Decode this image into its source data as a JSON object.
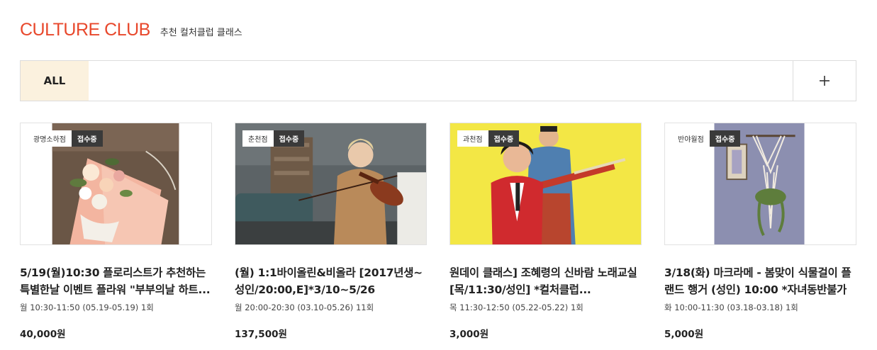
{
  "header": {
    "brand": "CULTURE CLUB",
    "subtitle": "추천 컬처클럽 클래스",
    "brand_color": "#e8482c"
  },
  "filter": {
    "tab_all": "ALL",
    "tab_active_bg": "#fbf1de",
    "more_icon": "plus-icon"
  },
  "cards": [
    {
      "branch": "광명소하점",
      "status": "접수중",
      "title": "5/19(월)10:30 플로리스트가 추천하는 특별한날 이벤트 플라워 \"부부의날 하트...",
      "schedule": "월 10:30-11:50 (05.19-05.19) 1회",
      "price": "40,000원",
      "image": "flower-bouquet"
    },
    {
      "branch": "춘천점",
      "status": "접수중",
      "title": "(월) 1:1바이올린&비올라 [2017년생~성인/20:00,E]*3/10~5/26",
      "schedule": "월 20:00-20:30 (03.10-05.26) 11회",
      "price": "137,500원",
      "image": "violin-player"
    },
    {
      "branch": "과천점",
      "status": "접수중",
      "title": "원데이 클래스] 조혜령의 신바람 노래교실 [목/11:30/성인] *컬처클럽...",
      "schedule": "목 11:30-12:50 (05.22-05.22) 1회",
      "price": "3,000원",
      "image": "singing-couple"
    },
    {
      "branch": "반야월점",
      "status": "접수중",
      "title": "3/18(화) 마크라메 - 봄맞이 식물걸이 플랜드 행거 (성인) 10:00 *자녀동반불가",
      "schedule": "화 10:00-11:30 (03.18-03.18) 1회",
      "price": "5,000원",
      "image": "macrame-hanger"
    }
  ]
}
